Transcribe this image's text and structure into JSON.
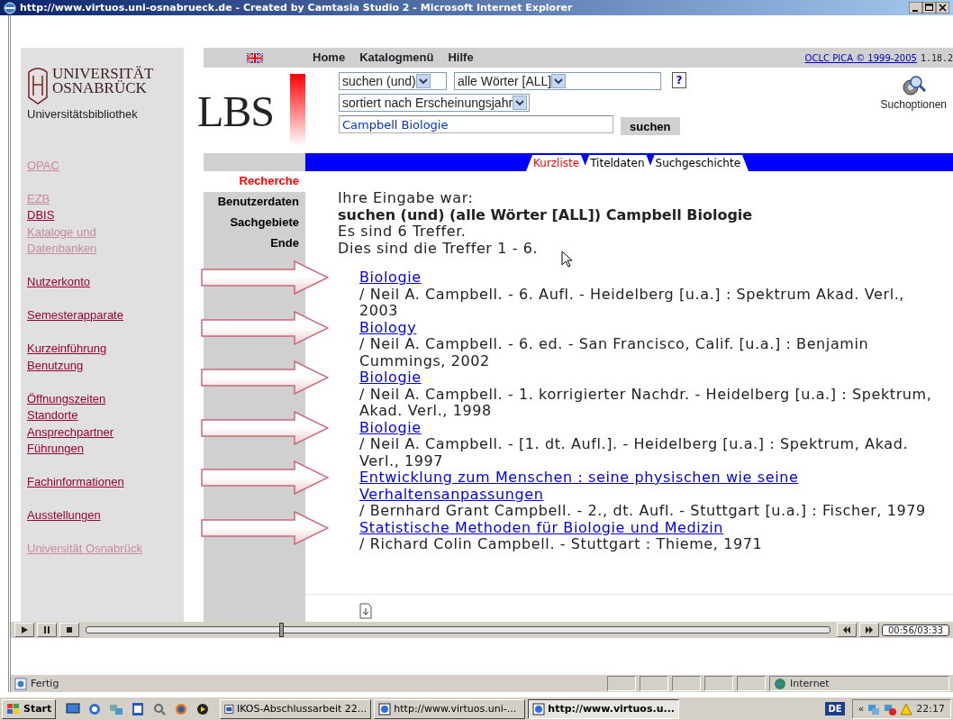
{
  "window": {
    "title": "http://www.virtuos.uni-osnabrueck.de - Created by Camtasia Studio 2 - Microsoft Internet Explorer"
  },
  "logo": {
    "line1": "UNIVERSITÄT",
    "line2": "OSNABRÜCK",
    "subtitle": "Universitätsbibliothek"
  },
  "sidebar": {
    "groups": [
      [
        {
          "label": "OPAC",
          "visited": true
        }
      ],
      [
        {
          "label": "EZB",
          "visited": true
        },
        {
          "label": "DBIS",
          "visited": false
        },
        {
          "label": "Kataloge und Datenbanken",
          "visited": true
        }
      ],
      [
        {
          "label": "Nutzerkonto",
          "visited": false
        }
      ],
      [
        {
          "label": "Semesterapparate",
          "visited": false
        }
      ],
      [
        {
          "label": "Kurzeinführung",
          "visited": false
        },
        {
          "label": "Benutzung",
          "visited": false
        }
      ],
      [
        {
          "label": "Öffnungszeiten",
          "visited": false
        },
        {
          "label": "Standorte",
          "visited": false
        },
        {
          "label": "Ansprechpartner",
          "visited": false
        },
        {
          "label": "Führungen",
          "visited": false
        }
      ],
      [
        {
          "label": "Fachinformationen",
          "visited": false
        }
      ],
      [
        {
          "label": "Ausstellungen",
          "visited": false
        }
      ],
      [
        {
          "label": "Universität Osnabrück",
          "visited": true
        }
      ]
    ]
  },
  "top_nav": [
    "Home",
    "Katalogmenü",
    "Hilfe"
  ],
  "copyright": "OCLC PICA © 1999-2005",
  "version": "1.18.2",
  "brand": "LBS",
  "search": {
    "operator": "suchen (und)",
    "field": "alle Wörter [ALL]",
    "help": "?",
    "sort": "sortiert nach Erscheinungsjahr",
    "query": "Campbell Biologie",
    "button": "suchen",
    "options": "Suchoptionen"
  },
  "tabs": [
    {
      "label": "Kurzliste",
      "selected": true
    },
    {
      "label": "Titeldaten",
      "selected": false
    },
    {
      "label": "Suchgeschichte",
      "selected": false
    }
  ],
  "menu": [
    {
      "label": "Recherche",
      "selected": true
    },
    {
      "label": "Benutzerdaten",
      "selected": false
    },
    {
      "label": "Sachgebiete",
      "selected": false
    },
    {
      "label": "Ende",
      "selected": false
    }
  ],
  "summary": {
    "intro": "Ihre Eingabe war:",
    "query": "suchen (und) (alle Wörter [ALL]) Campbell Biologie",
    "count": "Es sind 6 Treffer.",
    "range": "Dies sind die Treffer 1 - 6."
  },
  "results": [
    {
      "title": "Biologie",
      "details": "/ Neil A. Campbell. - 6. Aufl. - Heidelberg [u.a.] : Spektrum Akad. Verl., 2003",
      "arrow": true
    },
    {
      "title": "Biology",
      "details": "/ Neil A. Campbell. - 6. ed. - San Francisco, Calif. [u.a.] : Benjamin Cummings, 2002",
      "arrow": true
    },
    {
      "title": "Biologie",
      "details": "/ Neil A. Campbell. - 1. korrigierter Nachdr. - Heidelberg [u.a.] : Spektrum, Akad. Verl., 1998",
      "arrow": true
    },
    {
      "title": "Biologie",
      "details": "/ Neil A. Campbell. - [1. dt. Aufl.]. - Heidelberg [u.a.] : Spektrum, Akad. Verl., 1997",
      "arrow": true
    },
    {
      "title": "Entwicklung zum Menschen : seine physischen wie seine Verhaltensanpassungen",
      "details": "/ Bernhard Grant Campbell. - 2., dt. Aufl. - Stuttgart [u.a.] : Fischer, 1979",
      "arrow": true
    },
    {
      "title": "Statistische Methoden für Biologie und Medizin",
      "details": "/ Richard Colin Campbell. - Stuttgart : Thieme, 1971",
      "arrow": true
    }
  ],
  "player": {
    "level": 0.26,
    "time": "00:56/03:33"
  },
  "status_bar": {
    "text": "Fertig",
    "zone": "Internet"
  },
  "taskbar": {
    "start": "Start",
    "tasks": [
      {
        "label": "IKOS-Abschlussarbeit 22...",
        "kind": "document",
        "selected": false
      },
      {
        "label": "http://www.virtuos.uni-...",
        "kind": "browser",
        "selected": false
      },
      {
        "label": "http://www.virtuos.u...",
        "kind": "browser",
        "selected": true
      }
    ],
    "language": "DE",
    "tray_toggle": "«",
    "clock": "22:17"
  }
}
